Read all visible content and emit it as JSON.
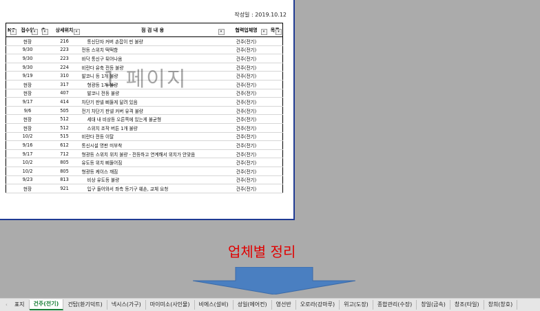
{
  "sheet": {
    "date_label": "작성일 : 2019.10.12",
    "watermark": "1 페이지",
    "headers": [
      "NO",
      "접수일",
      "층",
      "상세위치",
      "점 검 내 용",
      "협력업체명",
      "목록"
    ],
    "rows": [
      {
        "date": "현장",
        "loc": "216",
        "content": "통신단자 커버 손잡이 핀 불량",
        "vendor": "건주(전기)",
        "indent": true
      },
      {
        "date": "9/30",
        "loc": "223",
        "content": "전등 스위치 떡떡함",
        "vendor": "건주(전기)",
        "indent": false
      },
      {
        "date": "9/30",
        "loc": "223",
        "content": "바닥 통신구 튀어나옴",
        "vendor": "건주(전기)",
        "indent": false
      },
      {
        "date": "9/30",
        "loc": "224",
        "content": "비란다 유축 전등 불량",
        "vendor": "건주(전기)",
        "indent": false
      },
      {
        "date": "9/19",
        "loc": "310",
        "content": "발코니 등 1개 불량",
        "vendor": "건주(전기)",
        "indent": false
      },
      {
        "date": "현장",
        "loc": "317",
        "content": "형광등 1개 불량",
        "vendor": "건주(전기)",
        "indent": true
      },
      {
        "date": "현장",
        "loc": "407",
        "content": "발코니 전등 불량",
        "vendor": "건주(전기)",
        "indent": true
      },
      {
        "date": "9/17",
        "loc": "414",
        "content": "차단기 판넬 삐뚤게 달려 있음",
        "vendor": "건주(전기)",
        "indent": false
      },
      {
        "date": "9/6",
        "loc": "505",
        "content": "전기 차단기 판넬 커버 유격 불량",
        "vendor": "건주(전기)",
        "indent": false
      },
      {
        "date": "현장",
        "loc": "512",
        "content": "세대 내 비상등 오른쪽에 있는게 불균형",
        "vendor": "건주(전기)",
        "indent": true
      },
      {
        "date": "현장",
        "loc": "512",
        "content": "스위치 조작 버튼 1개 불량",
        "vendor": "건주(전기)",
        "indent": true
      },
      {
        "date": "10/2",
        "loc": "515",
        "content": "비란다 전등 이탈",
        "vendor": "건주(전기)",
        "indent": false
      },
      {
        "date": "9/16",
        "loc": "612",
        "content": "통신시설 명판 미부착",
        "vendor": "건주(전기)",
        "indent": false
      },
      {
        "date": "9/17",
        "loc": "712",
        "content": "형광등 스위치 위치 불량 - 전등하고 연계해서 위치가 안맞음",
        "vendor": "건주(전기)",
        "indent": false
      },
      {
        "date": "10/2",
        "loc": "805",
        "content": "유도등 위치 삐뚤어짐",
        "vendor": "건주(전기)",
        "indent": false
      },
      {
        "date": "10/2",
        "loc": "805",
        "content": "형광등 케이스 깨짐",
        "vendor": "건주(전기)",
        "indent": false
      },
      {
        "date": "9/23",
        "loc": "813",
        "content": "비상 유도등 불량",
        "vendor": "건주(전기)",
        "indent": true
      },
      {
        "date": "현장",
        "loc": "921",
        "content": "입구 들어와서 좌측 등기구 훼손, 교체 요청",
        "vendor": "건주(전기)",
        "indent": true
      }
    ]
  },
  "caption": "업체별 정리",
  "colors": {
    "caption": "#e00000",
    "arrow": "#4a7fc1",
    "active_tab": "#1a7f37"
  },
  "tabs": [
    "표지",
    "건주(전기)",
    "건탑(환기덕트)",
    "넥시스(가구)",
    "마이미소(사인물)",
    "비에스(설비)",
    "성일(에어컨)",
    "영선반",
    "오로라(강마루)",
    "위고(도장)",
    "종합관리(수장)",
    "창일(금속)",
    "창조(타일)",
    "창희(창호)"
  ],
  "active_tab": "건주(전기)",
  "tab_nav": "‹"
}
